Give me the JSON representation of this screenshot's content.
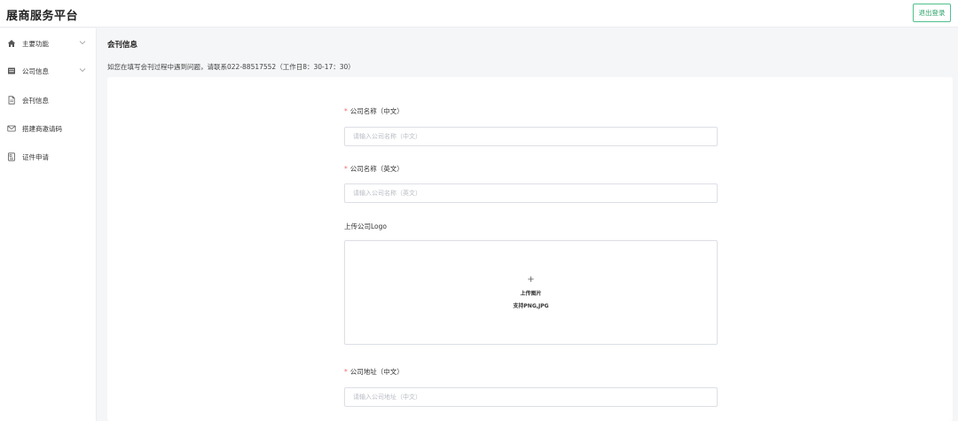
{
  "header": {
    "brand": "展商服务平台",
    "logout_label": "退出登录"
  },
  "sidebar": {
    "items": [
      {
        "label": "主要功能",
        "icon": "home-icon",
        "has_chevron": true
      },
      {
        "label": "公司信息",
        "icon": "building-icon",
        "has_chevron": true
      },
      {
        "label": "会刊信息",
        "icon": "document-icon",
        "has_chevron": false
      },
      {
        "label": "搭建商邀请码",
        "icon": "mail-icon",
        "has_chevron": false
      },
      {
        "label": "证件申请",
        "icon": "certificate-icon",
        "has_chevron": false
      }
    ]
  },
  "main": {
    "title": "会刊信息",
    "notice": "如您在填写会刊过程中遇到问题，请联系022-88517552（工作日8：30-17：30）",
    "form": {
      "company_name_cn": {
        "label": "公司名称（中文）",
        "required": true,
        "placeholder": "请输入公司名称（中文）",
        "value": ""
      },
      "company_name_en": {
        "label": "公司名称（英文）",
        "required": true,
        "placeholder": "请输入公司名称（英文）",
        "value": ""
      },
      "logo": {
        "label": "上传公司Logo",
        "upload_plus": "+",
        "upload_text": "上传图片",
        "upload_hint": "支持PNG,JPG"
      },
      "company_address_cn": {
        "label": "公司地址（中文）",
        "required": true,
        "placeholder": "请输入公司地址（中文）",
        "value": ""
      }
    }
  },
  "colors": {
    "accent": "#4fc08d",
    "required": "#f56c6c",
    "border": "#dcdfe6",
    "background": "#f5f6f8"
  }
}
